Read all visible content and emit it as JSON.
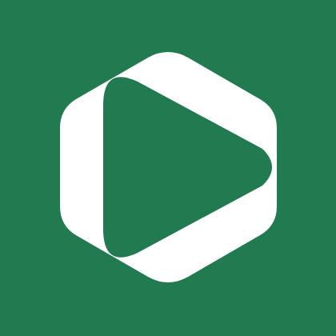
{
  "icon": {
    "name": "hexagon-play-logo",
    "background_color": "#217a50",
    "shape_color": "#ffffff",
    "play_color": "#217a50"
  }
}
